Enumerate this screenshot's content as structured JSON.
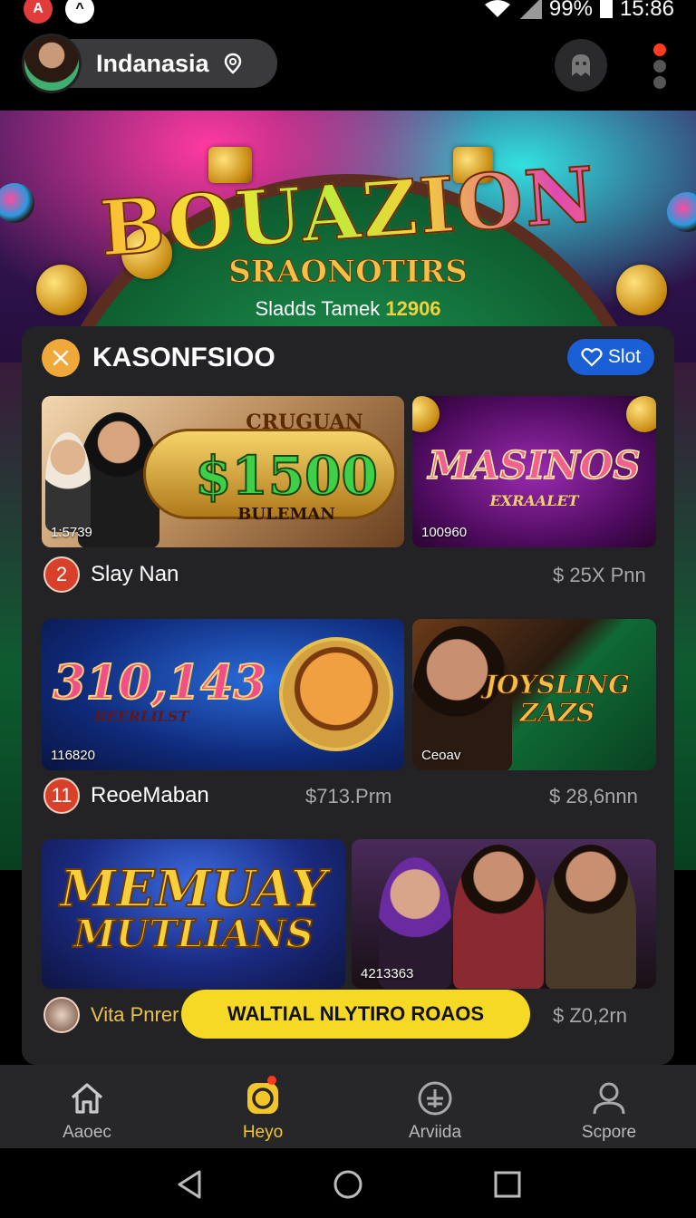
{
  "status_bar": {
    "battery": "99%",
    "time": "15:86"
  },
  "header": {
    "location": "Indanasia"
  },
  "hero": {
    "title": "BOUAZION",
    "subtitle": "SRAONOTIRS",
    "tagline": "Sladds Tamek",
    "tagline_number": "12906"
  },
  "card": {
    "title": "KASONFSIOO",
    "slot_button": "Slot",
    "tiles": [
      {
        "top": "CRUGUAN",
        "big": "$1500",
        "bottom": "BULEMAN",
        "caption": "1:5739"
      },
      {
        "big": "MASINOS",
        "bottom": "EXRAALET",
        "caption": "100960"
      },
      {
        "big": "310,143",
        "bottom": "BEERLILST",
        "caption": "116820"
      },
      {
        "big": "JOYSLING ZAZS",
        "caption": "Ceoav"
      },
      {
        "big": "MEMUAY",
        "bottom": "MUTLIANS"
      },
      {
        "caption": "4213363"
      }
    ],
    "rows": [
      {
        "badge": "2",
        "name": "Slay Nan",
        "price_right": "$ 25X Pnn"
      },
      {
        "badge": "11",
        "name": "ReoeMaban",
        "price_mid": "$713.Prm",
        "price_right": "$ 28,6nnn"
      },
      {
        "name": "Vita Pnrer",
        "price_right": "$ Z0,2rn"
      }
    ]
  },
  "cta": {
    "label": "WALTIAL NLYTIRO ROAOS"
  },
  "bottom_nav": [
    {
      "label": "Aaoec",
      "icon": "home-icon"
    },
    {
      "label": "Heyo",
      "icon": "target-icon",
      "active": true
    },
    {
      "label": "Arviida",
      "icon": "plus-circle-icon"
    },
    {
      "label": "Scpore",
      "icon": "user-icon"
    }
  ],
  "colors": {
    "accent": "#f5d924",
    "slot_button": "#1a5fd6",
    "badge": "#d8402a",
    "card_bg": "#232326"
  }
}
